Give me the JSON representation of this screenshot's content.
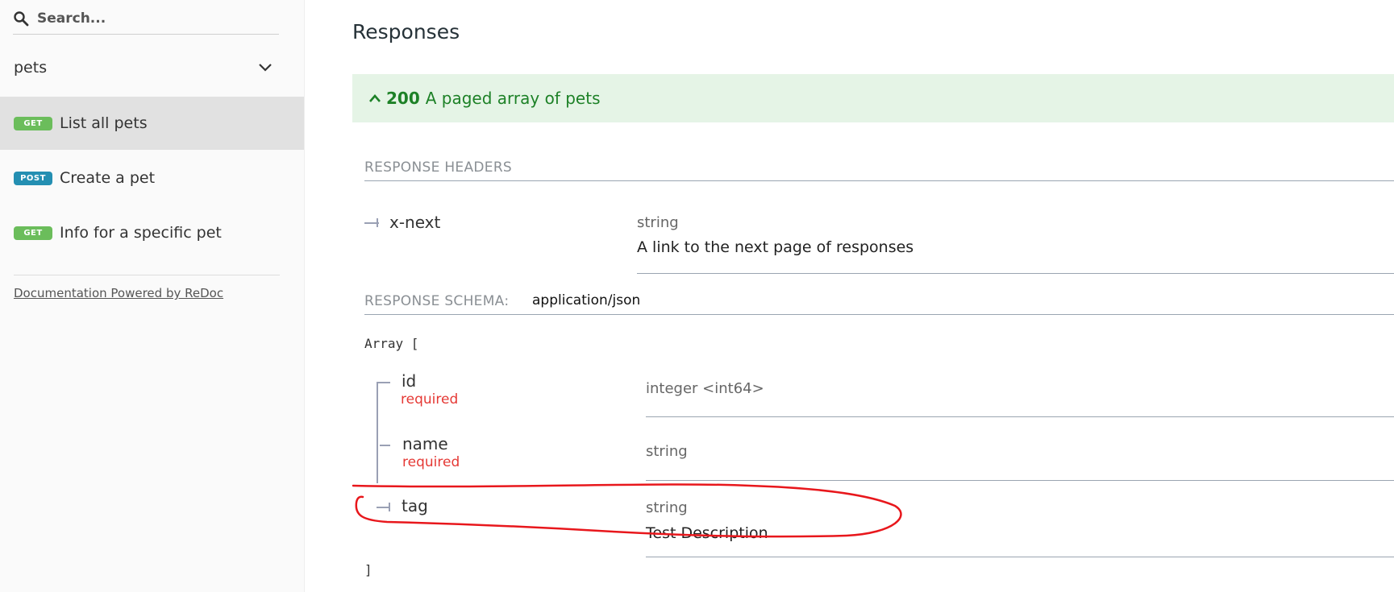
{
  "sidebar": {
    "search": {
      "placeholder": "Search...",
      "value": ""
    },
    "group": {
      "label": "pets"
    },
    "items": [
      {
        "method": "GET",
        "method_class": "get",
        "label": "List all pets",
        "active": true
      },
      {
        "method": "POST",
        "method_class": "post",
        "label": "Create a pet",
        "active": false
      },
      {
        "method": "GET",
        "method_class": "get",
        "label": "Info for a specific pet",
        "active": false
      }
    ],
    "powered_by": "Documentation Powered by ReDoc"
  },
  "main": {
    "title": "Responses",
    "response": {
      "code": "200",
      "description": "A paged array of pets"
    },
    "headers": {
      "label": "RESPONSE HEADERS",
      "items": [
        {
          "name": "x-next",
          "type": "string",
          "description": "A link to the next page of responses"
        }
      ]
    },
    "schema": {
      "label": "RESPONSE SCHEMA:",
      "content_type": "application/json",
      "open": "Array [",
      "close": "]",
      "properties": [
        {
          "name": "id",
          "required": "required",
          "type": "integer <int64>",
          "description": ""
        },
        {
          "name": "name",
          "required": "required",
          "type": "string",
          "description": ""
        },
        {
          "name": "tag",
          "required": "",
          "type": "string",
          "description": "Test Description"
        }
      ]
    }
  },
  "annotation": {
    "color": "#e8171c"
  },
  "colors": {
    "get_badge": "#6bbd5b",
    "post_badge": "#248fb2",
    "success_bg": "#e5f4e6",
    "success_text": "#1d8127",
    "required": "#e53935"
  }
}
